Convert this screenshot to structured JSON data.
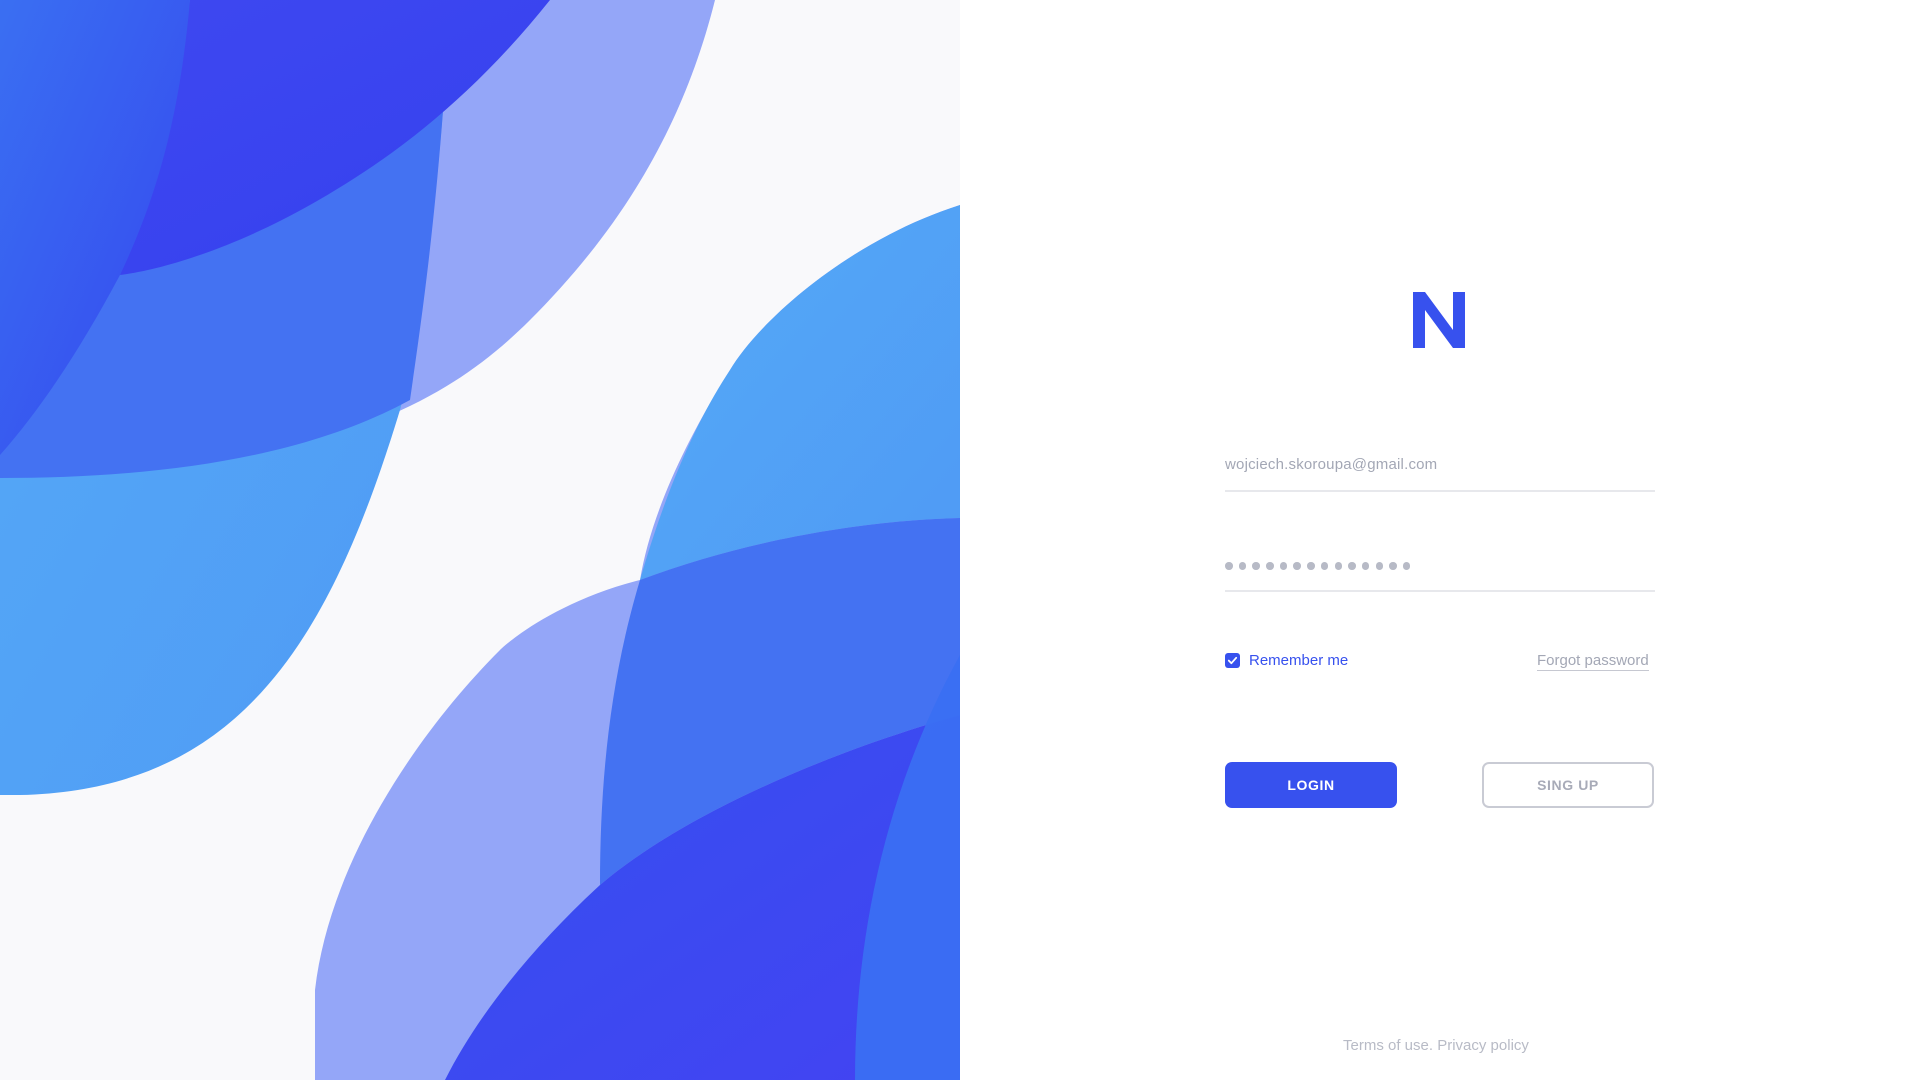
{
  "brand": {
    "logo_icon": "n-logo-icon",
    "accent": "#3751ee"
  },
  "login_form": {
    "email_value": "wojciech.skoroupa@gmail.com",
    "password_mask_length": 14,
    "remember_checked": true,
    "remember_label": "Remember me",
    "forgot_label": "Forgot password",
    "login_label": "LOGIN",
    "signup_label": "SING UP"
  },
  "footer": {
    "terms_label": "Terms of use.",
    "privacy_label": "Privacy policy"
  },
  "artwork": {
    "colors": [
      "#3571f0",
      "#3a4ff0",
      "#4473f2",
      "#52a5f5",
      "#94a6f8",
      "#3346f0"
    ]
  }
}
